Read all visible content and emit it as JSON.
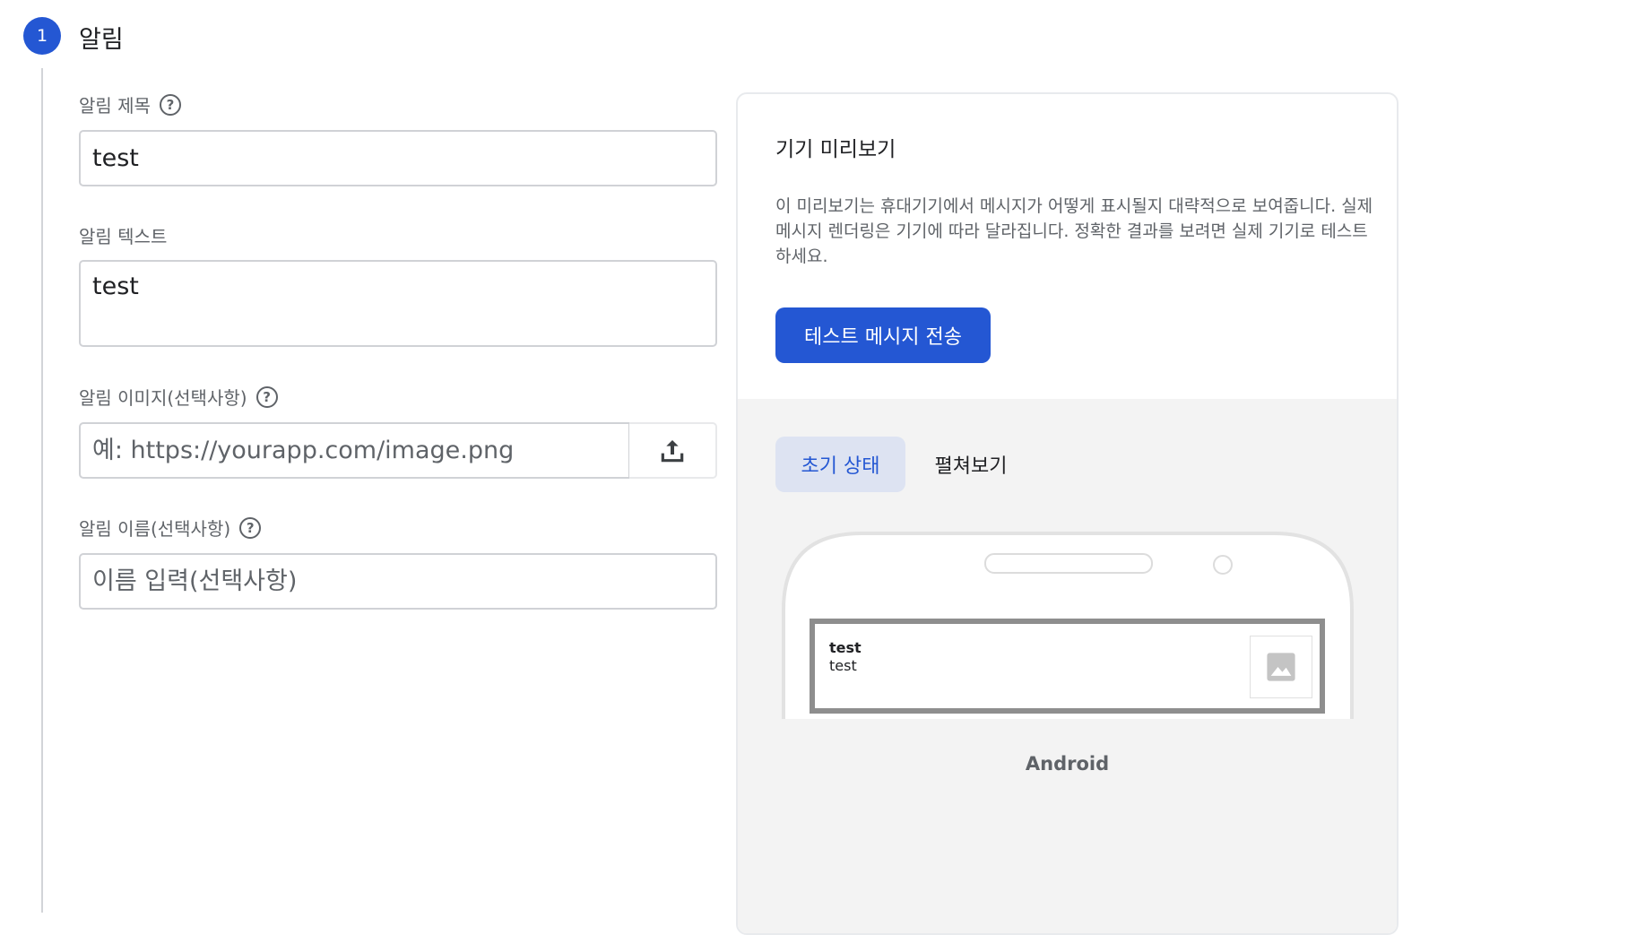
{
  "step": {
    "number": "1",
    "title": "알림"
  },
  "form": {
    "title_label": "알림 제목",
    "title_value": "test",
    "text_label": "알림 텍스트",
    "text_value": "test",
    "image_label": "알림 이미지(선택사항)",
    "image_placeholder": "예: https://yourapp.com/image.png",
    "name_label": "알림 이름(선택사항)",
    "name_placeholder": "이름 입력(선택사항)",
    "help_glyph": "?"
  },
  "preview": {
    "title": "기기 미리보기",
    "description": "이 미리보기는 휴대기기에서 메시지가 어떻게 표시될지 대략적으로 보여줍니다. 실제 메시지 렌더링은 기기에 따라 달라집니다. 정확한 결과를 보려면 실제 기기로 테스트하세요.",
    "send_button": "테스트 메시지 전송",
    "tabs": [
      {
        "label": "초기 상태",
        "active": true
      },
      {
        "label": "펼쳐보기",
        "active": false
      }
    ],
    "notification": {
      "title": "test",
      "body": "test",
      "thumb_icon": "image-placeholder-icon"
    },
    "device_label": "Android"
  },
  "colors": {
    "accent": "#2457d3",
    "tab_active_bg": "#dde3f2",
    "preview_bg": "#f3f3f3"
  }
}
